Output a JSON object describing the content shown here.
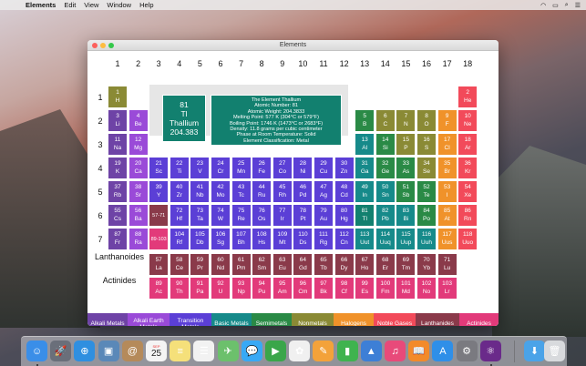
{
  "menubar": {
    "app_name": "Elements",
    "items": [
      "Edit",
      "View",
      "Window",
      "Help"
    ]
  },
  "window": {
    "title": "Elements"
  },
  "groups": [
    "1",
    "2",
    "3",
    "4",
    "5",
    "6",
    "7",
    "8",
    "9",
    "10",
    "11",
    "12",
    "13",
    "14",
    "15",
    "16",
    "17",
    "18"
  ],
  "periods": [
    "1",
    "2",
    "3",
    "4",
    "5",
    "6",
    "7"
  ],
  "row_labels": {
    "lanthanoides": "Lanthanoides",
    "actinides": "Actinides"
  },
  "colors": {
    "alkali": "#6e43a6",
    "alkaline": "#9a4ad8",
    "transition": "#5b3fd6",
    "basic": "#168a8a",
    "semimetal": "#2a8a46",
    "nonmetal": "#8a8a35",
    "halogen": "#f0922a",
    "noble": "#f24a5a",
    "lanthanide": "#8a3a4a",
    "actinide": "#e23a7a",
    "hydrogen": "#8a8a35",
    "selected": "#12806f"
  },
  "elements": [
    {
      "n": "1",
      "s": "H",
      "r": 1,
      "c": 1,
      "cat": "hydrogen"
    },
    {
      "n": "2",
      "s": "He",
      "r": 1,
      "c": 18,
      "cat": "noble"
    },
    {
      "n": "3",
      "s": "Li",
      "r": 2,
      "c": 1,
      "cat": "alkali"
    },
    {
      "n": "4",
      "s": "Be",
      "r": 2,
      "c": 2,
      "cat": "alkaline"
    },
    {
      "n": "5",
      "s": "B",
      "r": 2,
      "c": 13,
      "cat": "semimetal"
    },
    {
      "n": "6",
      "s": "C",
      "r": 2,
      "c": 14,
      "cat": "nonmetal"
    },
    {
      "n": "7",
      "s": "N",
      "r": 2,
      "c": 15,
      "cat": "nonmetal"
    },
    {
      "n": "8",
      "s": "O",
      "r": 2,
      "c": 16,
      "cat": "nonmetal"
    },
    {
      "n": "9",
      "s": "F",
      "r": 2,
      "c": 17,
      "cat": "halogen"
    },
    {
      "n": "10",
      "s": "Ne",
      "r": 2,
      "c": 18,
      "cat": "noble"
    },
    {
      "n": "11",
      "s": "Na",
      "r": 3,
      "c": 1,
      "cat": "alkali"
    },
    {
      "n": "12",
      "s": "Mg",
      "r": 3,
      "c": 2,
      "cat": "alkaline"
    },
    {
      "n": "13",
      "s": "Al",
      "r": 3,
      "c": 13,
      "cat": "basic"
    },
    {
      "n": "14",
      "s": "Si",
      "r": 3,
      "c": 14,
      "cat": "semimetal"
    },
    {
      "n": "15",
      "s": "P",
      "r": 3,
      "c": 15,
      "cat": "nonmetal"
    },
    {
      "n": "16",
      "s": "S",
      "r": 3,
      "c": 16,
      "cat": "nonmetal"
    },
    {
      "n": "17",
      "s": "Cl",
      "r": 3,
      "c": 17,
      "cat": "halogen"
    },
    {
      "n": "18",
      "s": "Ar",
      "r": 3,
      "c": 18,
      "cat": "noble"
    },
    {
      "n": "19",
      "s": "K",
      "r": 4,
      "c": 1,
      "cat": "alkali"
    },
    {
      "n": "20",
      "s": "Ca",
      "r": 4,
      "c": 2,
      "cat": "alkaline"
    },
    {
      "n": "21",
      "s": "Sc",
      "r": 4,
      "c": 3,
      "cat": "transition"
    },
    {
      "n": "22",
      "s": "Ti",
      "r": 4,
      "c": 4,
      "cat": "transition"
    },
    {
      "n": "23",
      "s": "V",
      "r": 4,
      "c": 5,
      "cat": "transition"
    },
    {
      "n": "24",
      "s": "Cr",
      "r": 4,
      "c": 6,
      "cat": "transition"
    },
    {
      "n": "25",
      "s": "Mn",
      "r": 4,
      "c": 7,
      "cat": "transition"
    },
    {
      "n": "26",
      "s": "Fe",
      "r": 4,
      "c": 8,
      "cat": "transition"
    },
    {
      "n": "27",
      "s": "Co",
      "r": 4,
      "c": 9,
      "cat": "transition"
    },
    {
      "n": "28",
      "s": "Ni",
      "r": 4,
      "c": 10,
      "cat": "transition"
    },
    {
      "n": "29",
      "s": "Cu",
      "r": 4,
      "c": 11,
      "cat": "transition"
    },
    {
      "n": "30",
      "s": "Zn",
      "r": 4,
      "c": 12,
      "cat": "transition"
    },
    {
      "n": "31",
      "s": "Ga",
      "r": 4,
      "c": 13,
      "cat": "basic"
    },
    {
      "n": "32",
      "s": "Ge",
      "r": 4,
      "c": 14,
      "cat": "semimetal"
    },
    {
      "n": "33",
      "s": "As",
      "r": 4,
      "c": 15,
      "cat": "semimetal"
    },
    {
      "n": "34",
      "s": "Se",
      "r": 4,
      "c": 16,
      "cat": "nonmetal"
    },
    {
      "n": "35",
      "s": "Br",
      "r": 4,
      "c": 17,
      "cat": "halogen"
    },
    {
      "n": "36",
      "s": "Kr",
      "r": 4,
      "c": 18,
      "cat": "noble"
    },
    {
      "n": "37",
      "s": "Rb",
      "r": 5,
      "c": 1,
      "cat": "alkali"
    },
    {
      "n": "38",
      "s": "Sr",
      "r": 5,
      "c": 2,
      "cat": "alkaline"
    },
    {
      "n": "39",
      "s": "Y",
      "r": 5,
      "c": 3,
      "cat": "transition"
    },
    {
      "n": "40",
      "s": "Zr",
      "r": 5,
      "c": 4,
      "cat": "transition"
    },
    {
      "n": "41",
      "s": "Nb",
      "r": 5,
      "c": 5,
      "cat": "transition"
    },
    {
      "n": "42",
      "s": "Mo",
      "r": 5,
      "c": 6,
      "cat": "transition"
    },
    {
      "n": "43",
      "s": "Tc",
      "r": 5,
      "c": 7,
      "cat": "transition"
    },
    {
      "n": "44",
      "s": "Ru",
      "r": 5,
      "c": 8,
      "cat": "transition"
    },
    {
      "n": "45",
      "s": "Rh",
      "r": 5,
      "c": 9,
      "cat": "transition"
    },
    {
      "n": "46",
      "s": "Pd",
      "r": 5,
      "c": 10,
      "cat": "transition"
    },
    {
      "n": "47",
      "s": "Ag",
      "r": 5,
      "c": 11,
      "cat": "transition"
    },
    {
      "n": "48",
      "s": "Cd",
      "r": 5,
      "c": 12,
      "cat": "transition"
    },
    {
      "n": "49",
      "s": "In",
      "r": 5,
      "c": 13,
      "cat": "basic"
    },
    {
      "n": "50",
      "s": "Sn",
      "r": 5,
      "c": 14,
      "cat": "basic"
    },
    {
      "n": "51",
      "s": "Sb",
      "r": 5,
      "c": 15,
      "cat": "semimetal"
    },
    {
      "n": "52",
      "s": "Te",
      "r": 5,
      "c": 16,
      "cat": "semimetal"
    },
    {
      "n": "53",
      "s": "I",
      "r": 5,
      "c": 17,
      "cat": "halogen"
    },
    {
      "n": "54",
      "s": "Xe",
      "r": 5,
      "c": 18,
      "cat": "noble"
    },
    {
      "n": "55",
      "s": "Cs",
      "r": 6,
      "c": 1,
      "cat": "alkali"
    },
    {
      "n": "56",
      "s": "Ba",
      "r": 6,
      "c": 2,
      "cat": "alkaline"
    },
    {
      "n": "57-71",
      "s": "",
      "r": 6,
      "c": 3,
      "cat": "lanthanide",
      "range": true
    },
    {
      "n": "72",
      "s": "Hf",
      "r": 6,
      "c": 4,
      "cat": "transition"
    },
    {
      "n": "73",
      "s": "Ta",
      "r": 6,
      "c": 5,
      "cat": "transition"
    },
    {
      "n": "74",
      "s": "W",
      "r": 6,
      "c": 6,
      "cat": "transition"
    },
    {
      "n": "75",
      "s": "Re",
      "r": 6,
      "c": 7,
      "cat": "transition"
    },
    {
      "n": "76",
      "s": "Os",
      "r": 6,
      "c": 8,
      "cat": "transition"
    },
    {
      "n": "77",
      "s": "Ir",
      "r": 6,
      "c": 9,
      "cat": "transition"
    },
    {
      "n": "78",
      "s": "Pt",
      "r": 6,
      "c": 10,
      "cat": "transition"
    },
    {
      "n": "79",
      "s": "Au",
      "r": 6,
      "c": 11,
      "cat": "transition"
    },
    {
      "n": "80",
      "s": "Hg",
      "r": 6,
      "c": 12,
      "cat": "transition"
    },
    {
      "n": "81",
      "s": "Tl",
      "r": 6,
      "c": 13,
      "cat": "selected"
    },
    {
      "n": "82",
      "s": "Pb",
      "r": 6,
      "c": 14,
      "cat": "basic"
    },
    {
      "n": "83",
      "s": "Bi",
      "r": 6,
      "c": 15,
      "cat": "basic"
    },
    {
      "n": "84",
      "s": "Po",
      "r": 6,
      "c": 16,
      "cat": "semimetal"
    },
    {
      "n": "85",
      "s": "At",
      "r": 6,
      "c": 17,
      "cat": "halogen"
    },
    {
      "n": "86",
      "s": "Rn",
      "r": 6,
      "c": 18,
      "cat": "noble"
    },
    {
      "n": "87",
      "s": "Fr",
      "r": 7,
      "c": 1,
      "cat": "alkali"
    },
    {
      "n": "88",
      "s": "Ra",
      "r": 7,
      "c": 2,
      "cat": "alkaline"
    },
    {
      "n": "89-103",
      "s": "",
      "r": 7,
      "c": 3,
      "cat": "actinide",
      "range": true
    },
    {
      "n": "104",
      "s": "Rf",
      "r": 7,
      "c": 4,
      "cat": "transition"
    },
    {
      "n": "105",
      "s": "Db",
      "r": 7,
      "c": 5,
      "cat": "transition"
    },
    {
      "n": "106",
      "s": "Sg",
      "r": 7,
      "c": 6,
      "cat": "transition"
    },
    {
      "n": "107",
      "s": "Bh",
      "r": 7,
      "c": 7,
      "cat": "transition"
    },
    {
      "n": "108",
      "s": "Hs",
      "r": 7,
      "c": 8,
      "cat": "transition"
    },
    {
      "n": "109",
      "s": "Mt",
      "r": 7,
      "c": 9,
      "cat": "transition"
    },
    {
      "n": "110",
      "s": "Ds",
      "r": 7,
      "c": 10,
      "cat": "transition"
    },
    {
      "n": "111",
      "s": "Rg",
      "r": 7,
      "c": 11,
      "cat": "transition"
    },
    {
      "n": "112",
      "s": "Cn",
      "r": 7,
      "c": 12,
      "cat": "transition"
    },
    {
      "n": "113",
      "s": "Uut",
      "r": 7,
      "c": 13,
      "cat": "basic"
    },
    {
      "n": "114",
      "s": "Uuq",
      "r": 7,
      "c": 14,
      "cat": "basic"
    },
    {
      "n": "115",
      "s": "Uup",
      "r": 7,
      "c": 15,
      "cat": "basic"
    },
    {
      "n": "116",
      "s": "Uuh",
      "r": 7,
      "c": 16,
      "cat": "basic"
    },
    {
      "n": "117",
      "s": "Uus",
      "r": 7,
      "c": 17,
      "cat": "halogen"
    },
    {
      "n": "118",
      "s": "Uuo",
      "r": 7,
      "c": 18,
      "cat": "noble"
    },
    {
      "n": "57",
      "s": "La",
      "r": 8,
      "c": 3,
      "cat": "lanthanide"
    },
    {
      "n": "58",
      "s": "Ce",
      "r": 8,
      "c": 4,
      "cat": "lanthanide"
    },
    {
      "n": "59",
      "s": "Pr",
      "r": 8,
      "c": 5,
      "cat": "lanthanide"
    },
    {
      "n": "60",
      "s": "Nd",
      "r": 8,
      "c": 6,
      "cat": "lanthanide"
    },
    {
      "n": "61",
      "s": "Pm",
      "r": 8,
      "c": 7,
      "cat": "lanthanide"
    },
    {
      "n": "62",
      "s": "Sm",
      "r": 8,
      "c": 8,
      "cat": "lanthanide"
    },
    {
      "n": "63",
      "s": "Eu",
      "r": 8,
      "c": 9,
      "cat": "lanthanide"
    },
    {
      "n": "64",
      "s": "Gd",
      "r": 8,
      "c": 10,
      "cat": "lanthanide"
    },
    {
      "n": "65",
      "s": "Tb",
      "r": 8,
      "c": 11,
      "cat": "lanthanide"
    },
    {
      "n": "66",
      "s": "Dy",
      "r": 8,
      "c": 12,
      "cat": "lanthanide"
    },
    {
      "n": "67",
      "s": "Ho",
      "r": 8,
      "c": 13,
      "cat": "lanthanide"
    },
    {
      "n": "68",
      "s": "Er",
      "r": 8,
      "c": 14,
      "cat": "lanthanide"
    },
    {
      "n": "69",
      "s": "Tm",
      "r": 8,
      "c": 15,
      "cat": "lanthanide"
    },
    {
      "n": "70",
      "s": "Yb",
      "r": 8,
      "c": 16,
      "cat": "lanthanide"
    },
    {
      "n": "71",
      "s": "Lu",
      "r": 8,
      "c": 17,
      "cat": "lanthanide"
    },
    {
      "n": "89",
      "s": "Ac",
      "r": 9,
      "c": 3,
      "cat": "actinide"
    },
    {
      "n": "90",
      "s": "Th",
      "r": 9,
      "c": 4,
      "cat": "actinide"
    },
    {
      "n": "91",
      "s": "Pa",
      "r": 9,
      "c": 5,
      "cat": "actinide"
    },
    {
      "n": "92",
      "s": "U",
      "r": 9,
      "c": 6,
      "cat": "actinide"
    },
    {
      "n": "93",
      "s": "Np",
      "r": 9,
      "c": 7,
      "cat": "actinide"
    },
    {
      "n": "94",
      "s": "Pu",
      "r": 9,
      "c": 8,
      "cat": "actinide"
    },
    {
      "n": "95",
      "s": "Am",
      "r": 9,
      "c": 9,
      "cat": "actinide"
    },
    {
      "n": "96",
      "s": "Cm",
      "r": 9,
      "c": 10,
      "cat": "actinide"
    },
    {
      "n": "97",
      "s": "Bk",
      "r": 9,
      "c": 11,
      "cat": "actinide"
    },
    {
      "n": "98",
      "s": "Cf",
      "r": 9,
      "c": 12,
      "cat": "actinide"
    },
    {
      "n": "99",
      "s": "Es",
      "r": 9,
      "c": 13,
      "cat": "actinide"
    },
    {
      "n": "100",
      "s": "Fm",
      "r": 9,
      "c": 14,
      "cat": "actinide"
    },
    {
      "n": "101",
      "s": "Md",
      "r": 9,
      "c": 15,
      "cat": "actinide"
    },
    {
      "n": "102",
      "s": "No",
      "r": 9,
      "c": 16,
      "cat": "actinide"
    },
    {
      "n": "103",
      "s": "Lr",
      "r": 9,
      "c": 17,
      "cat": "actinide"
    }
  ],
  "selected_element": {
    "number": "81",
    "symbol": "Tl",
    "name": "Thallium",
    "weight": "204.383",
    "info_lines": [
      "The Element Thallium",
      "Atomic Number: 81",
      "Atomic Weight: 204.3833",
      "Melting Point: 577 K (304°C or 579°F)",
      "Boiling Point: 1746 K (1473°C or 2683°F)",
      "Density: 11.8 grams per cubic centimeter",
      "Phase at Room Temperature: Solid",
      "Element Classification: Metal"
    ]
  },
  "legend": [
    {
      "label": "Alkali Metals",
      "cat": "alkali"
    },
    {
      "label": "Alkali Earth Metals",
      "cat": "alkaline"
    },
    {
      "label": "Transition Metals",
      "cat": "transition"
    },
    {
      "label": "Basic Metals",
      "cat": "basic"
    },
    {
      "label": "Semimetals",
      "cat": "semimetal"
    },
    {
      "label": "Nonmetals",
      "cat": "nonmetal"
    },
    {
      "label": "Halogens",
      "cat": "halogen"
    },
    {
      "label": "Noble Gases",
      "cat": "noble"
    },
    {
      "label": "Lanthanides",
      "cat": "lanthanide"
    },
    {
      "label": "Actinides",
      "cat": "actinide"
    }
  ],
  "calendar": {
    "month": "SEP",
    "day": "25"
  },
  "dock": [
    {
      "name": "finder-icon",
      "color": "#3a8ee8",
      "glyph": "☺"
    },
    {
      "name": "launchpad-icon",
      "color": "#6a6f7a",
      "glyph": "🚀"
    },
    {
      "name": "safari-icon",
      "color": "#2f8fe0",
      "glyph": "⊕"
    },
    {
      "name": "photos-preview-icon",
      "color": "#5a88b8",
      "glyph": "▣"
    },
    {
      "name": "contacts-icon",
      "color": "#b58a5a",
      "glyph": "@"
    },
    {
      "name": "calendar-icon",
      "color": "#f4f4f4",
      "glyph": ""
    },
    {
      "name": "notes-icon",
      "color": "#f5e07a",
      "glyph": "≡"
    },
    {
      "name": "reminders-icon",
      "color": "#f2f2f2",
      "glyph": "☰"
    },
    {
      "name": "maps-icon",
      "color": "#6cc06c",
      "glyph": "✈"
    },
    {
      "name": "messages-icon",
      "color": "#38a9f5",
      "glyph": "💬"
    },
    {
      "name": "facetime-icon",
      "color": "#3aa64a",
      "glyph": "▶"
    },
    {
      "name": "photos-icon",
      "color": "#f0f0f0",
      "glyph": "✿"
    },
    {
      "name": "pages-icon",
      "color": "#f3a23a",
      "glyph": "✎"
    },
    {
      "name": "numbers-icon",
      "color": "#3fb34f",
      "glyph": "▮"
    },
    {
      "name": "keynote-icon",
      "color": "#3d7fd6",
      "glyph": "▲"
    },
    {
      "name": "itunes-icon",
      "color": "#e84a7a",
      "glyph": "♫"
    },
    {
      "name": "ibooks-icon",
      "color": "#f28a2a",
      "glyph": "📖"
    },
    {
      "name": "app-store-icon",
      "color": "#2f8fe8",
      "glyph": "A"
    },
    {
      "name": "system-preferences-icon",
      "color": "#7a7a80",
      "glyph": "⚙"
    },
    {
      "name": "elements-app-icon",
      "color": "#6a2a8a",
      "glyph": "⚛"
    },
    {
      "name": "downloads-folder-icon",
      "color": "#4aa3e8",
      "glyph": "⬇"
    },
    {
      "name": "trash-icon",
      "color": "#d8dadd",
      "glyph": "🗑"
    }
  ]
}
